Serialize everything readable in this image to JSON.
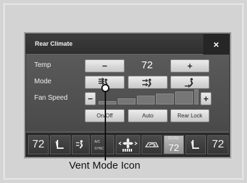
{
  "window": {
    "title": "Rear Climate",
    "close_label": "×"
  },
  "temp": {
    "label": "Temp",
    "minus": "−",
    "value": "72",
    "plus": "+"
  },
  "mode": {
    "label": "Mode",
    "buttons": [
      "vent-mode-icon",
      "bi-level-mode-icon",
      "floor-mode-icon"
    ]
  },
  "fan": {
    "label": "Fan Speed",
    "minus": "−",
    "plus": "+",
    "level_of_max": 0.0
  },
  "controls": {
    "onoff": "On/Off",
    "auto": "Auto",
    "rear_lock": "Rear Lock"
  },
  "bottom_bar": {
    "left_temp": "72",
    "right_temp": "72",
    "dual_label": "DUAL",
    "ac_label": "A/C",
    "sync_label": "SYNC",
    "dual_temp": "72"
  },
  "caption": "Vent Mode Icon"
}
